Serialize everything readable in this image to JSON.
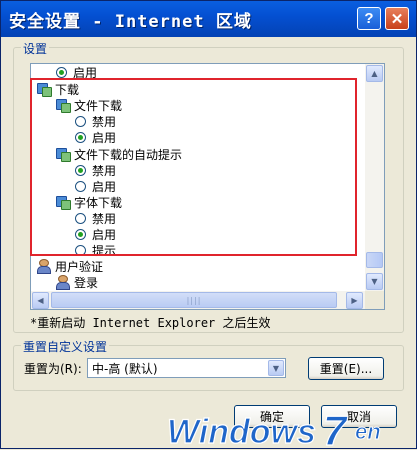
{
  "window": {
    "title": "安全设置 - Internet 区域"
  },
  "settings_group": {
    "label": "设置"
  },
  "tree": [
    {
      "kind": "radio",
      "label": "启用",
      "checked": true
    },
    {
      "kind": "folder",
      "label": "下载"
    },
    {
      "kind": "folder",
      "label": "文件下载"
    },
    {
      "kind": "radio",
      "label": "禁用",
      "checked": false
    },
    {
      "kind": "radio",
      "label": "启用",
      "checked": true
    },
    {
      "kind": "folder",
      "label": "文件下载的自动提示"
    },
    {
      "kind": "radio",
      "label": "禁用",
      "checked": true
    },
    {
      "kind": "radio",
      "label": "启用",
      "checked": false
    },
    {
      "kind": "folder",
      "label": "字体下载"
    },
    {
      "kind": "radio",
      "label": "禁用",
      "checked": false
    },
    {
      "kind": "radio",
      "label": "启用",
      "checked": true
    },
    {
      "kind": "radio",
      "label": "提示",
      "checked": false
    },
    {
      "kind": "user",
      "label": "用户验证"
    },
    {
      "kind": "user",
      "label": "登录"
    }
  ],
  "note": "*重新启动 Internet Explorer 之后生效",
  "reset_group": {
    "label": "重置自定义设置",
    "reset_to_label": "重置为(R):",
    "select_value": "中-高 (默认)",
    "reset_button": "重置(E)..."
  },
  "footer": {
    "ok_label": "确定",
    "cancel_label": "取消"
  },
  "watermark": {
    "text": "Windows7en",
    "main": "Windows",
    "num": "7",
    "suffix": "en"
  },
  "colors": {
    "titlebar": "#0450D2",
    "highlight": "#E0242C",
    "watermark_blue": "#1F66C9"
  }
}
